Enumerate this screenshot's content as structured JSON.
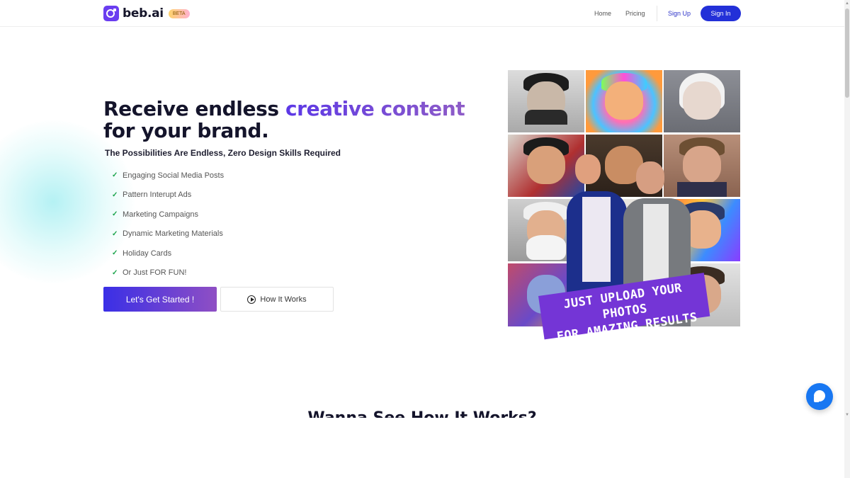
{
  "brand": {
    "name": "beb.ai",
    "badge": "BETA"
  },
  "nav": {
    "home": "Home",
    "pricing": "Pricing",
    "sign_up": "Sign Up",
    "sign_in": "Sign In"
  },
  "hero": {
    "headline_start": "Receive endless ",
    "headline_accent": "creative content",
    "headline_end": " for your brand.",
    "subheadline": "The Possibilities Are Endless, Zero Design Skills Required",
    "features": [
      "Engaging Social Media Posts",
      "Pattern Interupt Ads",
      "Marketing Campaigns",
      "Dynamic Marketing Materials",
      "Holiday Cards",
      "Or Just FOR FUN!"
    ],
    "check_glyph": "✓",
    "cta_primary": "Let's Get Started !",
    "cta_secondary": "How It Works"
  },
  "collage": {
    "banner_line1": "JUST UPLOAD YOUR PHOTOS",
    "banner_line2": "FOR AMAZING RESULTS"
  },
  "next_section": {
    "title": "Wanna See How It Works?"
  },
  "colors": {
    "accent": "#5c38e6",
    "button_blue": "#2330d8",
    "check_green": "#1aa34a",
    "banner": "#7435d6",
    "chat": "#1877f2"
  }
}
